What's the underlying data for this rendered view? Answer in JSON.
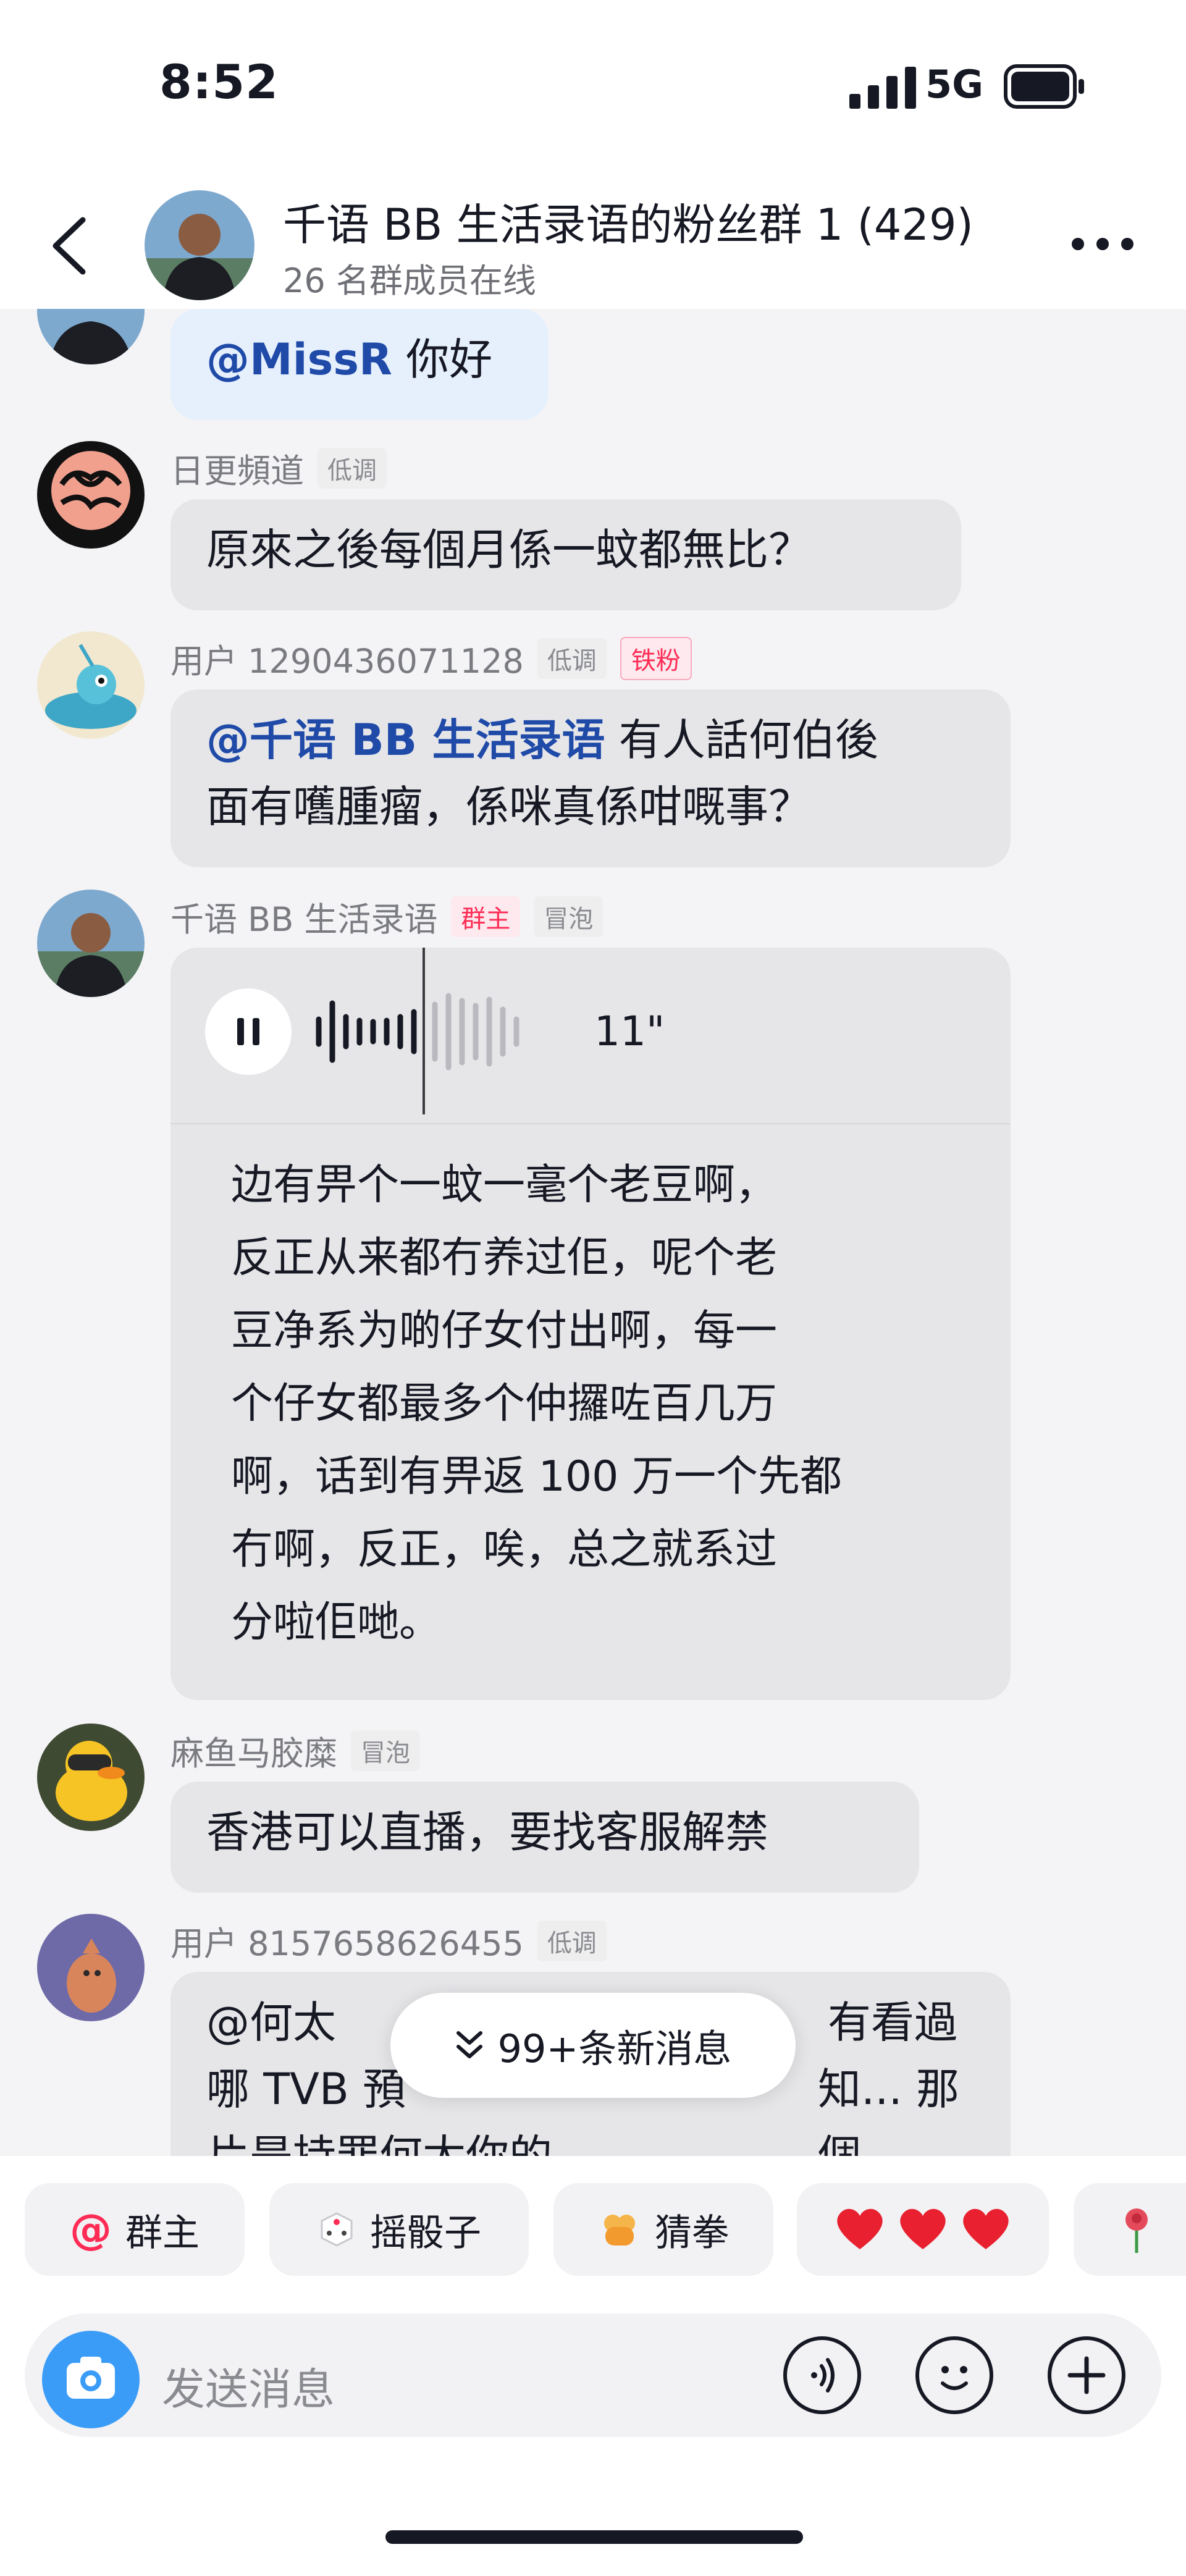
{
  "status_bar": {
    "time": "8:52",
    "network": "5G"
  },
  "header": {
    "title": "千语 BB 生活录语的粉丝群 1 (429)",
    "subtitle": "26 名群成员在线"
  },
  "messages": [
    {
      "text_mention": "@MissR",
      "text": " 你好"
    },
    {
      "name": "日更頻道",
      "badges": [
        "低调"
      ],
      "text": "原來之後每個月係一蚊都無比？"
    },
    {
      "name": "用户 1290436071128",
      "badges": [
        "低调",
        "铁粉"
      ],
      "text_mention": "@千语 BB 生活录语",
      "line1": " 有人話何伯後",
      "line2": "面有嚿腫瘤，係咪真係咁嘅事？"
    },
    {
      "name": "千语 BB 生活录语",
      "badges": [
        "群主",
        "冒泡"
      ],
      "voice_duration": "11\"",
      "transcript": [
        "边有畀个一蚊一毫个老豆啊，",
        "反正从来都冇养过佢，呢个老",
        "豆净系为啲仔女付出啊，每一",
        "个仔女都最多个仲攞咗百几万",
        "啊，话到有畀返 100 万一个先都",
        "冇啊，反正，唉，总之就系过",
        "分啦佢哋。"
      ]
    },
    {
      "name": "麻鱼马胶糜",
      "badges": [
        "冒泡"
      ],
      "text": "香港可以直播，要找客服解禁"
    },
    {
      "name": "用户 8157658626455",
      "badges": [
        "低调"
      ],
      "line1_a": "@何太 ",
      "line1_b": "有看過",
      "line2_a": "哪 TVB 預",
      "line2_b": "知... 那個",
      "line3": "片是持罪何太你的"
    }
  ],
  "new_messages_pill": "99+条新消息",
  "quick_actions": [
    {
      "label": "群主",
      "icon": "at-icon"
    },
    {
      "label": "摇骰子",
      "icon": "dice-icon"
    },
    {
      "label": "猜拳",
      "icon": "fist-icon"
    },
    {
      "label": "",
      "icon": "hearts-icon"
    },
    {
      "label": "",
      "icon": "rose-icon"
    }
  ],
  "input": {
    "placeholder": "发送消息"
  },
  "colors": {
    "accent_blue": "#3b9cf7",
    "mention_blue": "#1f4aa8",
    "badge_red": "#fe2c55",
    "bubble_gray": "#e6e6e9",
    "bubble_blue": "#e6f0fd"
  }
}
